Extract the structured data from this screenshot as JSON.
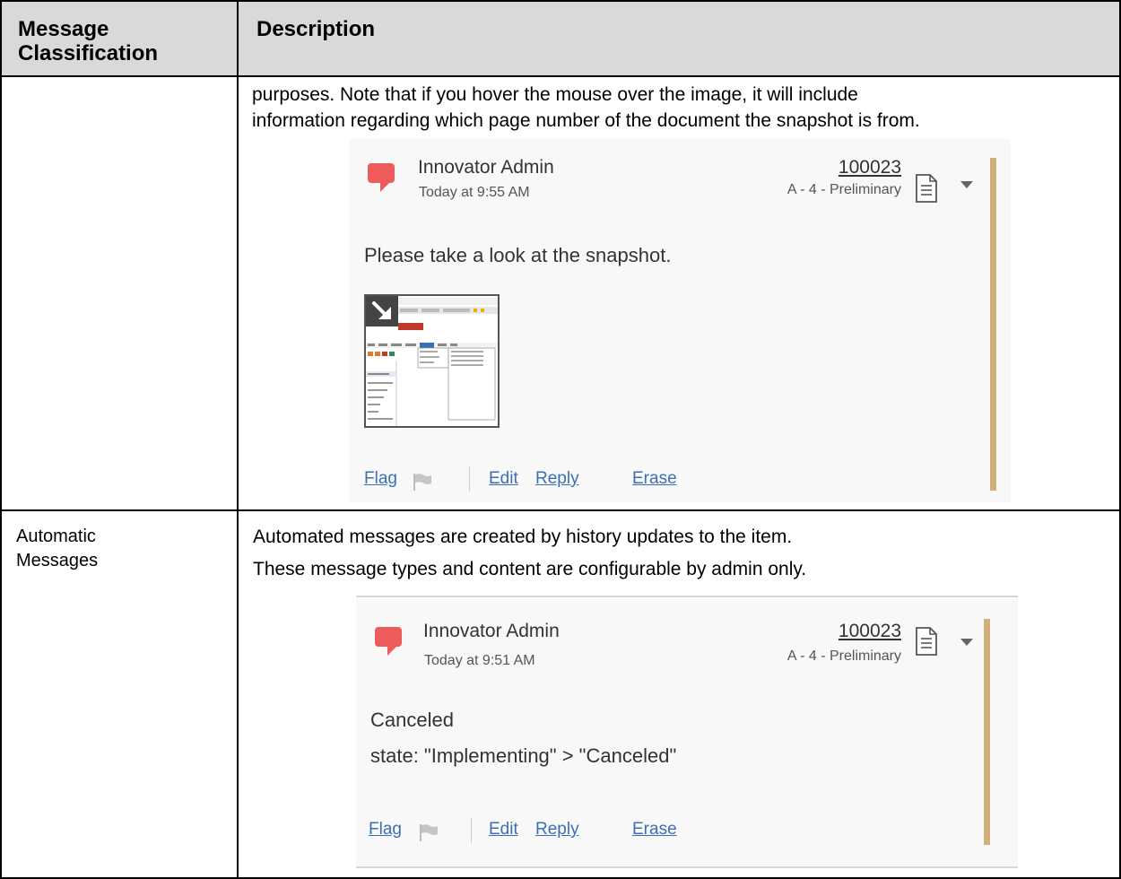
{
  "table": {
    "headers": [
      "Message Classification",
      "Description"
    ],
    "header_col1_line1": "Message",
    "header_col1_line2": "Classification",
    "header_col2": "Description"
  },
  "row1": {
    "classification": "",
    "desc_line1": "purposes.  Note that if you hover the mouse over the image, it will include",
    "desc_line2": "information regarding which page number of the document the snapshot is from.",
    "card": {
      "author": "Innovator Admin",
      "time": "Today at 9:55 AM",
      "item_number": "100023",
      "item_state": "A - 4 - Preliminary",
      "message": "Please take a look at the snapshot.",
      "actions": {
        "flag": "Flag",
        "edit": "Edit",
        "reply": "Reply",
        "erase": "Erase"
      }
    }
  },
  "row2": {
    "classification_line1": "Automatic",
    "classification_line2": "Messages",
    "desc_line1": "Automated messages are created by history updates to the item.",
    "desc_line2": "These message types and content are configurable by admin only.",
    "card": {
      "author": "Innovator Admin",
      "time": "Today at 9:51 AM",
      "item_number": "100023",
      "item_state": "A - 4 - Preliminary",
      "message_line1": "Canceled",
      "message_line2": "state: \"Implementing\" > \"Canceled\"",
      "actions": {
        "flag": "Flag",
        "edit": "Edit",
        "reply": "Reply",
        "erase": "Erase"
      }
    }
  },
  "colors": {
    "header_bg": "#d9d9d9",
    "bubble": "#ee5b5b",
    "accent_bar": "#d1b07c",
    "link": "#3b6fb5"
  },
  "icons": [
    "chat-bubble-icon",
    "document-icon",
    "dropdown-caret-icon",
    "flag-icon",
    "expand-arrow-icon"
  ]
}
